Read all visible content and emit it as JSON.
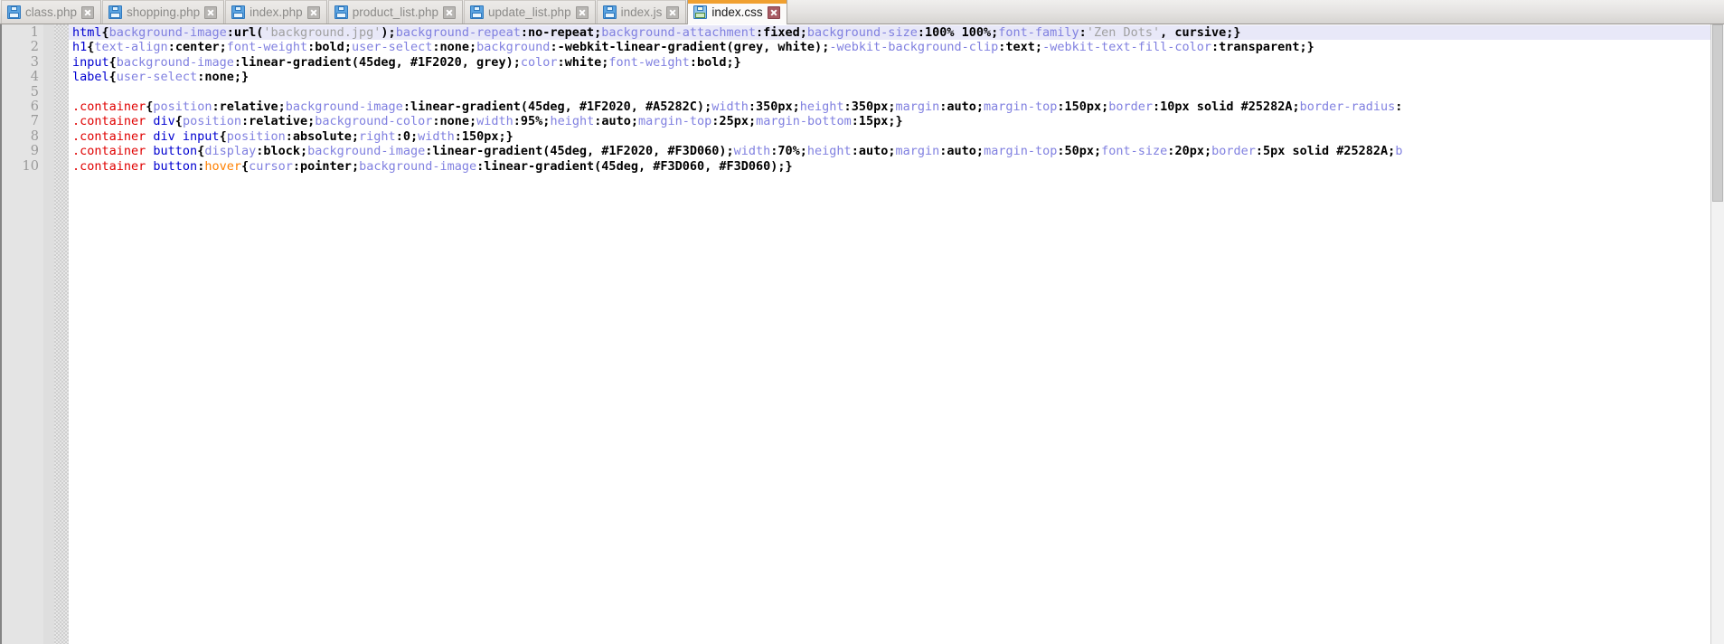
{
  "window": {
    "app": "code-editor",
    "active_file": "index.css"
  },
  "tabs": [
    {
      "label": "class.php",
      "icon": "floppy-disk-icon",
      "close_icon": "close-icon",
      "active": false
    },
    {
      "label": "shopping.php",
      "icon": "floppy-disk-icon",
      "close_icon": "close-icon",
      "active": false
    },
    {
      "label": "index.php",
      "icon": "floppy-disk-icon",
      "close_icon": "close-icon",
      "active": false
    },
    {
      "label": "product_list.php",
      "icon": "floppy-disk-icon",
      "close_icon": "close-icon",
      "active": false
    },
    {
      "label": "update_list.php",
      "icon": "floppy-disk-icon",
      "close_icon": "close-icon",
      "active": false
    },
    {
      "label": "index.js",
      "icon": "floppy-disk-icon",
      "close_icon": "close-icon",
      "active": false
    },
    {
      "label": "index.css",
      "icon": "floppy-disk-icon",
      "close_icon": "close-icon",
      "active": true
    }
  ],
  "colors": {
    "tab_active_accent": "#F0A030",
    "tab_active_close": "#A85B63",
    "current_line_highlight": "#E8E8F8",
    "selector_element": "#0000D0",
    "selector_class": "#E00000",
    "pseudo_class": "#FF8000",
    "property": "#8080E0",
    "value": "#000000",
    "string": "#A0A0A0",
    "gutter_bg": "#E4E4E4",
    "linenumber": "#9A9A9A"
  },
  "editor": {
    "line_numbers": [
      "1",
      "2",
      "3",
      "4",
      "5",
      "6",
      "7",
      "8",
      "9",
      "10"
    ],
    "current_line": 1,
    "lines": [
      {
        "n": 1,
        "tokens": [
          {
            "t": "sel",
            "v": "html"
          },
          {
            "t": "punc",
            "v": "{"
          },
          {
            "t": "prop",
            "v": "background-image"
          },
          {
            "t": "punc",
            "v": ":"
          },
          {
            "t": "val",
            "v": "url"
          },
          {
            "t": "punc",
            "v": "("
          },
          {
            "t": "str",
            "v": "'background.jpg'"
          },
          {
            "t": "punc",
            "v": ");"
          },
          {
            "t": "prop",
            "v": "background-repeat"
          },
          {
            "t": "punc",
            "v": ":"
          },
          {
            "t": "val",
            "v": "no-repeat"
          },
          {
            "t": "punc",
            "v": ";"
          },
          {
            "t": "prop",
            "v": "background-attachment"
          },
          {
            "t": "punc",
            "v": ":"
          },
          {
            "t": "val",
            "v": "fixed"
          },
          {
            "t": "punc",
            "v": ";"
          },
          {
            "t": "prop",
            "v": "background-size"
          },
          {
            "t": "punc",
            "v": ":"
          },
          {
            "t": "val",
            "v": "100% 100%"
          },
          {
            "t": "punc",
            "v": ";"
          },
          {
            "t": "prop",
            "v": "font-family"
          },
          {
            "t": "punc",
            "v": ":"
          },
          {
            "t": "str",
            "v": "'Zen Dots'"
          },
          {
            "t": "val",
            "v": ", cursive;}"
          }
        ]
      },
      {
        "n": 2,
        "tokens": [
          {
            "t": "sel",
            "v": "h1"
          },
          {
            "t": "punc",
            "v": "{"
          },
          {
            "t": "prop",
            "v": "text-align"
          },
          {
            "t": "punc",
            "v": ":"
          },
          {
            "t": "val",
            "v": "center"
          },
          {
            "t": "punc",
            "v": ";"
          },
          {
            "t": "prop",
            "v": "font-weight"
          },
          {
            "t": "punc",
            "v": ":"
          },
          {
            "t": "val",
            "v": "bold"
          },
          {
            "t": "punc",
            "v": ";"
          },
          {
            "t": "prop",
            "v": "user-select"
          },
          {
            "t": "punc",
            "v": ":"
          },
          {
            "t": "val",
            "v": "none"
          },
          {
            "t": "punc",
            "v": ";"
          },
          {
            "t": "prop",
            "v": "background"
          },
          {
            "t": "punc",
            "v": ":"
          },
          {
            "t": "val",
            "v": "-webkit-linear-gradient(grey, white)"
          },
          {
            "t": "punc",
            "v": ";"
          },
          {
            "t": "prop",
            "v": "-webkit-background-clip"
          },
          {
            "t": "punc",
            "v": ":"
          },
          {
            "t": "val",
            "v": "text"
          },
          {
            "t": "punc",
            "v": ";"
          },
          {
            "t": "prop",
            "v": "-webkit-text-fill-color"
          },
          {
            "t": "punc",
            "v": ":"
          },
          {
            "t": "val",
            "v": "transparent;}"
          }
        ]
      },
      {
        "n": 3,
        "tokens": [
          {
            "t": "sel",
            "v": "input"
          },
          {
            "t": "punc",
            "v": "{"
          },
          {
            "t": "prop",
            "v": "background-image"
          },
          {
            "t": "punc",
            "v": ":"
          },
          {
            "t": "val",
            "v": "linear-gradient(45deg, #1F2020, grey)"
          },
          {
            "t": "punc",
            "v": ";"
          },
          {
            "t": "prop",
            "v": "color"
          },
          {
            "t": "punc",
            "v": ":"
          },
          {
            "t": "val",
            "v": "white"
          },
          {
            "t": "punc",
            "v": ";"
          },
          {
            "t": "prop",
            "v": "font-weight"
          },
          {
            "t": "punc",
            "v": ":"
          },
          {
            "t": "val",
            "v": "bold;}"
          }
        ]
      },
      {
        "n": 4,
        "tokens": [
          {
            "t": "sel",
            "v": "label"
          },
          {
            "t": "punc",
            "v": "{"
          },
          {
            "t": "prop",
            "v": "user-select"
          },
          {
            "t": "punc",
            "v": ":"
          },
          {
            "t": "val",
            "v": "none;}"
          }
        ]
      },
      {
        "n": 5,
        "tokens": []
      },
      {
        "n": 6,
        "tokens": [
          {
            "t": "class",
            "v": ".container"
          },
          {
            "t": "punc",
            "v": "{"
          },
          {
            "t": "prop",
            "v": "position"
          },
          {
            "t": "punc",
            "v": ":"
          },
          {
            "t": "val",
            "v": "relative"
          },
          {
            "t": "punc",
            "v": ";"
          },
          {
            "t": "prop",
            "v": "background-image"
          },
          {
            "t": "punc",
            "v": ":"
          },
          {
            "t": "val",
            "v": "linear-gradient(45deg, #1F2020, #A5282C)"
          },
          {
            "t": "punc",
            "v": ";"
          },
          {
            "t": "prop",
            "v": "width"
          },
          {
            "t": "punc",
            "v": ":"
          },
          {
            "t": "val",
            "v": "350px"
          },
          {
            "t": "punc",
            "v": ";"
          },
          {
            "t": "prop",
            "v": "height"
          },
          {
            "t": "punc",
            "v": ":"
          },
          {
            "t": "val",
            "v": "350px"
          },
          {
            "t": "punc",
            "v": ";"
          },
          {
            "t": "prop",
            "v": "margin"
          },
          {
            "t": "punc",
            "v": ":"
          },
          {
            "t": "val",
            "v": "auto"
          },
          {
            "t": "punc",
            "v": ";"
          },
          {
            "t": "prop",
            "v": "margin-top"
          },
          {
            "t": "punc",
            "v": ":"
          },
          {
            "t": "val",
            "v": "150px"
          },
          {
            "t": "punc",
            "v": ";"
          },
          {
            "t": "prop",
            "v": "border"
          },
          {
            "t": "punc",
            "v": ":"
          },
          {
            "t": "val",
            "v": "10px solid #25282A"
          },
          {
            "t": "punc",
            "v": ";"
          },
          {
            "t": "prop",
            "v": "border-radius"
          },
          {
            "t": "punc",
            "v": ":"
          }
        ]
      },
      {
        "n": 7,
        "tokens": [
          {
            "t": "class",
            "v": ".container "
          },
          {
            "t": "sel",
            "v": "div"
          },
          {
            "t": "punc",
            "v": "{"
          },
          {
            "t": "prop",
            "v": "position"
          },
          {
            "t": "punc",
            "v": ":"
          },
          {
            "t": "val",
            "v": "relative"
          },
          {
            "t": "punc",
            "v": ";"
          },
          {
            "t": "prop",
            "v": "background-color"
          },
          {
            "t": "punc",
            "v": ":"
          },
          {
            "t": "val",
            "v": "none"
          },
          {
            "t": "punc",
            "v": ";"
          },
          {
            "t": "prop",
            "v": "width"
          },
          {
            "t": "punc",
            "v": ":"
          },
          {
            "t": "val",
            "v": "95%"
          },
          {
            "t": "punc",
            "v": ";"
          },
          {
            "t": "prop",
            "v": "height"
          },
          {
            "t": "punc",
            "v": ":"
          },
          {
            "t": "val",
            "v": "auto"
          },
          {
            "t": "punc",
            "v": ";"
          },
          {
            "t": "prop",
            "v": "margin-top"
          },
          {
            "t": "punc",
            "v": ":"
          },
          {
            "t": "val",
            "v": "25px"
          },
          {
            "t": "punc",
            "v": ";"
          },
          {
            "t": "prop",
            "v": "margin-bottom"
          },
          {
            "t": "punc",
            "v": ":"
          },
          {
            "t": "val",
            "v": "15px;}"
          }
        ]
      },
      {
        "n": 8,
        "tokens": [
          {
            "t": "class",
            "v": ".container "
          },
          {
            "t": "sel",
            "v": "div input"
          },
          {
            "t": "punc",
            "v": "{"
          },
          {
            "t": "prop",
            "v": "position"
          },
          {
            "t": "punc",
            "v": ":"
          },
          {
            "t": "val",
            "v": "absolute"
          },
          {
            "t": "punc",
            "v": ";"
          },
          {
            "t": "prop",
            "v": "right"
          },
          {
            "t": "punc",
            "v": ":"
          },
          {
            "t": "val",
            "v": "0"
          },
          {
            "t": "punc",
            "v": ";"
          },
          {
            "t": "prop",
            "v": "width"
          },
          {
            "t": "punc",
            "v": ":"
          },
          {
            "t": "val",
            "v": "150px;}"
          }
        ]
      },
      {
        "n": 9,
        "tokens": [
          {
            "t": "class",
            "v": ".container "
          },
          {
            "t": "sel",
            "v": "button"
          },
          {
            "t": "punc",
            "v": "{"
          },
          {
            "t": "prop",
            "v": "display"
          },
          {
            "t": "punc",
            "v": ":"
          },
          {
            "t": "val",
            "v": "block"
          },
          {
            "t": "punc",
            "v": ";"
          },
          {
            "t": "prop",
            "v": "background-image"
          },
          {
            "t": "punc",
            "v": ":"
          },
          {
            "t": "val",
            "v": "linear-gradient(45deg, #1F2020, #F3D060)"
          },
          {
            "t": "punc",
            "v": ";"
          },
          {
            "t": "prop",
            "v": "width"
          },
          {
            "t": "punc",
            "v": ":"
          },
          {
            "t": "val",
            "v": "70%"
          },
          {
            "t": "punc",
            "v": ";"
          },
          {
            "t": "prop",
            "v": "height"
          },
          {
            "t": "punc",
            "v": ":"
          },
          {
            "t": "val",
            "v": "auto"
          },
          {
            "t": "punc",
            "v": ";"
          },
          {
            "t": "prop",
            "v": "margin"
          },
          {
            "t": "punc",
            "v": ":"
          },
          {
            "t": "val",
            "v": "auto"
          },
          {
            "t": "punc",
            "v": ";"
          },
          {
            "t": "prop",
            "v": "margin-top"
          },
          {
            "t": "punc",
            "v": ":"
          },
          {
            "t": "val",
            "v": "50px"
          },
          {
            "t": "punc",
            "v": ";"
          },
          {
            "t": "prop",
            "v": "font-size"
          },
          {
            "t": "punc",
            "v": ":"
          },
          {
            "t": "val",
            "v": "20px"
          },
          {
            "t": "punc",
            "v": ";"
          },
          {
            "t": "prop",
            "v": "border"
          },
          {
            "t": "punc",
            "v": ":"
          },
          {
            "t": "val",
            "v": "5px solid #25282A;"
          },
          {
            "t": "prop",
            "v": "b"
          }
        ]
      },
      {
        "n": 10,
        "tokens": [
          {
            "t": "class",
            "v": ".container "
          },
          {
            "t": "sel",
            "v": "button"
          },
          {
            "t": "punc",
            "v": ":"
          },
          {
            "t": "pseudo",
            "v": "hover"
          },
          {
            "t": "punc",
            "v": "{"
          },
          {
            "t": "prop",
            "v": "cursor"
          },
          {
            "t": "punc",
            "v": ":"
          },
          {
            "t": "val",
            "v": "pointer"
          },
          {
            "t": "punc",
            "v": ";"
          },
          {
            "t": "prop",
            "v": "background-image"
          },
          {
            "t": "punc",
            "v": ":"
          },
          {
            "t": "val",
            "v": "linear-gradient(45deg, #F3D060, #F3D060);}"
          }
        ]
      }
    ]
  }
}
